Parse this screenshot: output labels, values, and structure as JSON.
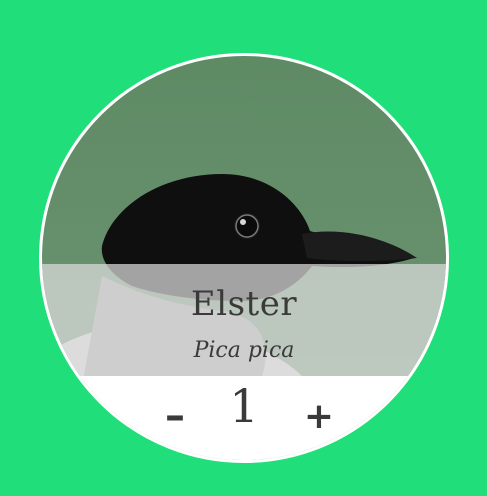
{
  "bird": {
    "name": "Elster",
    "latin_name": "Pica pica",
    "image_subject": "magpie-head-photo"
  },
  "counter": {
    "value": "1",
    "decrement_label": "–",
    "increment_label": "+"
  },
  "colors": {
    "background": "#20DF7A",
    "card": "#FFFFFF",
    "text": "#3A3A3A",
    "photo_background": "#5E8A64"
  }
}
